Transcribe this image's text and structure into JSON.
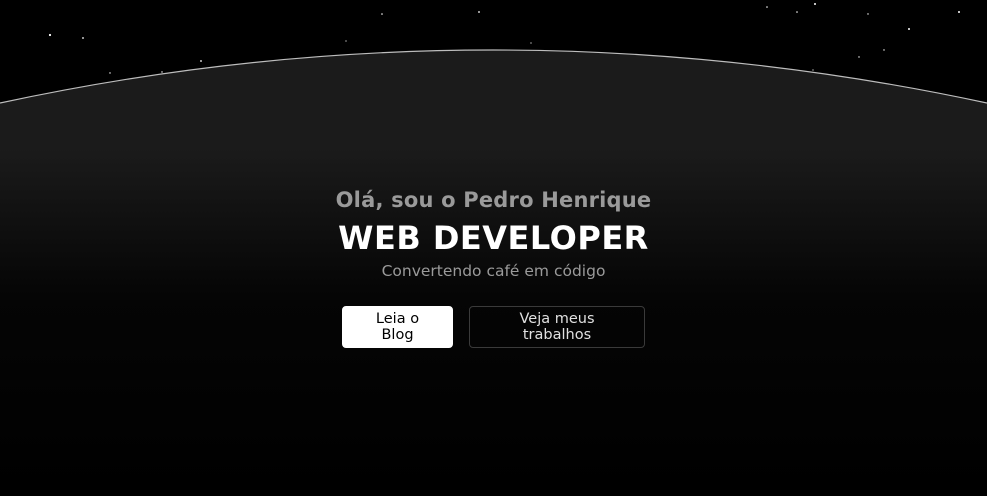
{
  "hero": {
    "greeting": "Olá, sou o Pedro Henrique",
    "headline": "WEB DEVELOPER",
    "tagline": "Convertendo café em código"
  },
  "actions": {
    "primary_label": "Leia o Blog",
    "secondary_label": "Veja meus trabalhos"
  },
  "colors": {
    "background": "#000000",
    "planet_top": "#1b1b1b",
    "horizon_line": "#bdbdbd",
    "muted_text": "#9a9a9a",
    "accent_text": "#ffffff"
  }
}
